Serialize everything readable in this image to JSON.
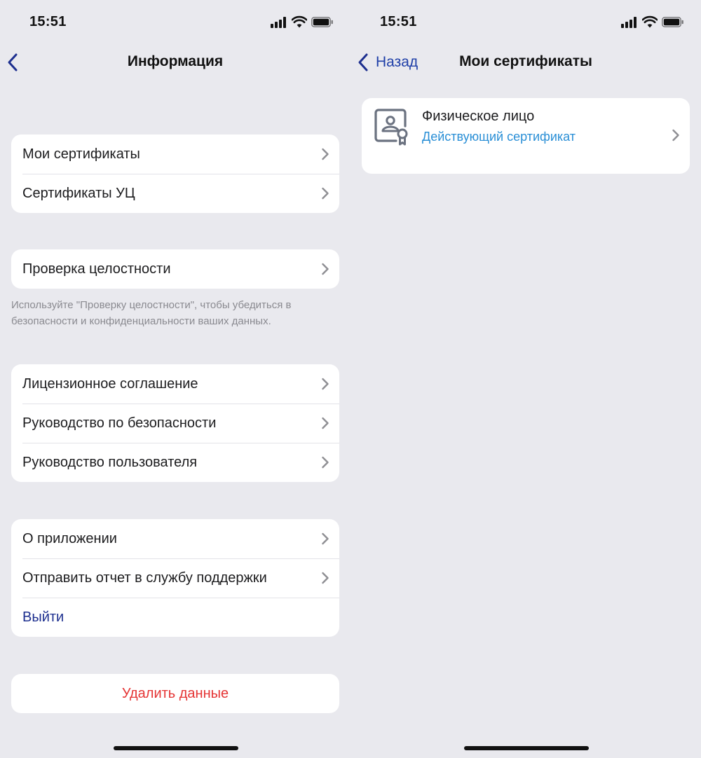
{
  "status_bar": {
    "time": "15:51"
  },
  "info_screen": {
    "title": "Информация",
    "group1": [
      {
        "label": "Мои сертификаты"
      },
      {
        "label": "Сертификаты УЦ"
      }
    ],
    "group2": [
      {
        "label": "Проверка целостности"
      }
    ],
    "integrity_note": "Используйте \"Проверку целостности\", чтобы убедиться в безопасности и конфиденциальности ваших данных.",
    "group3": [
      {
        "label": "Лицензионное соглашение"
      },
      {
        "label": "Руководство по безопасности"
      },
      {
        "label": "Руководство пользователя"
      }
    ],
    "group4": [
      {
        "label": "О приложении"
      },
      {
        "label": "Отправить отчет в службу поддержки"
      },
      {
        "label": "Выйти"
      }
    ],
    "delete_label": "Удалить данные"
  },
  "certs_screen": {
    "back_label": "Назад",
    "title": "Мои сертификаты",
    "certificate": {
      "title": "Физическое лицо",
      "status": "Действующий сертификат"
    }
  },
  "colors": {
    "background": "#e9e9ee",
    "link": "#1d2f8f",
    "status_blue": "#2a8fd6",
    "danger": "#e53535",
    "separator": "#e3e3e8",
    "footnote": "#8a8a90"
  },
  "icons": [
    "signal-icon",
    "wifi-icon",
    "battery-icon",
    "back-chevron-icon",
    "chevron-right-icon",
    "certificate-icon"
  ]
}
